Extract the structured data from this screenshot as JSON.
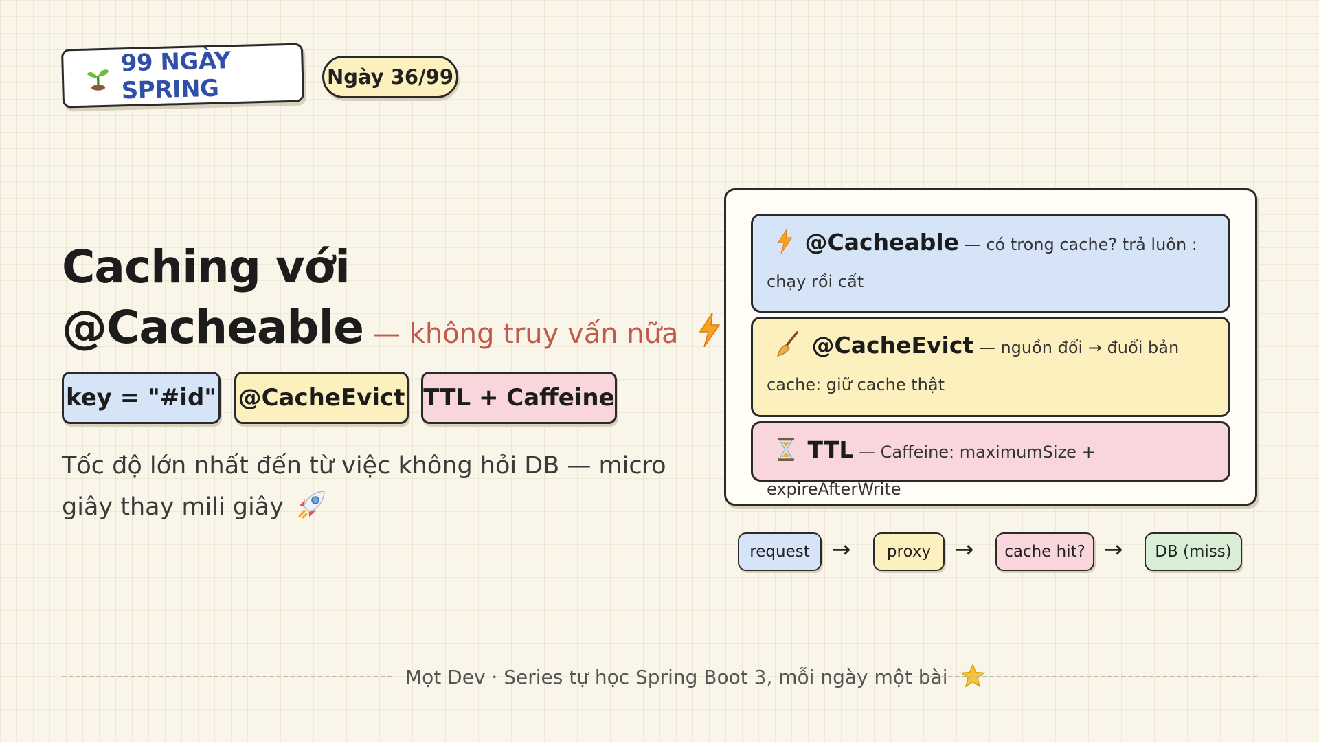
{
  "brand": {
    "icon": "sprout-icon",
    "label": "99 NGÀY SPRING"
  },
  "day_badge": "Ngày 36/99",
  "title": {
    "line1": "Caching với",
    "accent": "@Cacheable",
    "subtitle": "— không truy vấn nữa",
    "icon": "lightning-icon"
  },
  "tags": [
    "key = \"#id\"",
    "@CacheEvict",
    "TTL + Caffeine"
  ],
  "description": "Tốc độ lớn nhất đến từ việc không hỏi DB — micro giây thay mili giây",
  "description_icon": "rocket-icon",
  "cards": [
    {
      "icon": "lightning-icon",
      "keyword": "@Cacheable",
      "text": "— có trong cache? trả luôn : chạy rồi cất"
    },
    {
      "icon": "broom-icon",
      "keyword": "@CacheEvict",
      "text": "— nguồn đổi → đuổi bản cache: giữ cache thật"
    },
    {
      "icon": "hourglass-icon",
      "keyword": "TTL",
      "text": "— Caffeine: maximumSize + expireAfterWrite"
    }
  ],
  "flow": [
    "request",
    "proxy",
    "cache hit?",
    "DB (miss)"
  ],
  "flow_arrow": "→",
  "footer": {
    "text": "Mọt Dev · Series tự học Spring Boot 3, mỗi ngày một bài",
    "icon": "star-icon"
  },
  "colors": {
    "blue": "#d6e4f7",
    "yellow": "#fcf1be",
    "pink": "#f9d5dc",
    "green": "#d8efd6",
    "accent_red": "#c25a4c",
    "brand_blue": "#2f4fa8"
  }
}
